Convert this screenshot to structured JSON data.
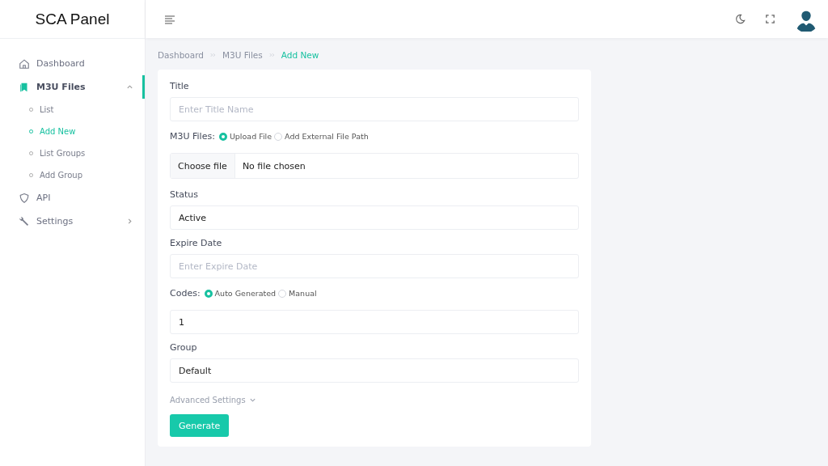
{
  "brand": "SCA Panel",
  "sidebar": {
    "items": [
      {
        "kind": "home",
        "label": "Dashboard",
        "selected": false
      },
      {
        "kind": "files",
        "label": "M3U Files",
        "selected": true,
        "expanded": true,
        "children": [
          {
            "label": "List",
            "selected": false
          },
          {
            "label": "Add New",
            "selected": true
          },
          {
            "label": "List Groups",
            "selected": false
          },
          {
            "label": "Add Group",
            "selected": false
          }
        ]
      },
      {
        "kind": "shield",
        "label": "API",
        "selected": false
      },
      {
        "kind": "wrench",
        "label": "Settings",
        "selected": false,
        "expanded": false
      }
    ]
  },
  "breadcrumb": [
    {
      "label": "Dashboard",
      "selected": false
    },
    {
      "label": "M3U Files",
      "selected": false
    },
    {
      "label": "Add New",
      "selected": true
    }
  ],
  "form": {
    "fields": [
      {
        "kind": "text",
        "label": "Title",
        "placeholder": "Enter Title Name"
      },
      {
        "kind": "radio",
        "label": "M3U Files:",
        "options": [
          {
            "label": "Upload File",
            "selected": true
          },
          {
            "label": "Add External File Path",
            "selected": false
          }
        ]
      },
      {
        "kind": "file",
        "button": "Choose file",
        "value": "No file chosen"
      },
      {
        "kind": "text",
        "label": "Status",
        "value": "Active"
      },
      {
        "kind": "text",
        "label": "Expire Date",
        "placeholder": "Enter Expire Date"
      },
      {
        "kind": "radio",
        "label": "Codes:",
        "options": [
          {
            "label": "Auto Generated",
            "selected": true
          },
          {
            "label": "Manual",
            "selected": false
          }
        ]
      },
      {
        "kind": "text",
        "value": "1"
      },
      {
        "kind": "text",
        "label": "Group",
        "value": "Default"
      }
    ],
    "advanced": "Advanced Settings",
    "submit": "Generate"
  }
}
